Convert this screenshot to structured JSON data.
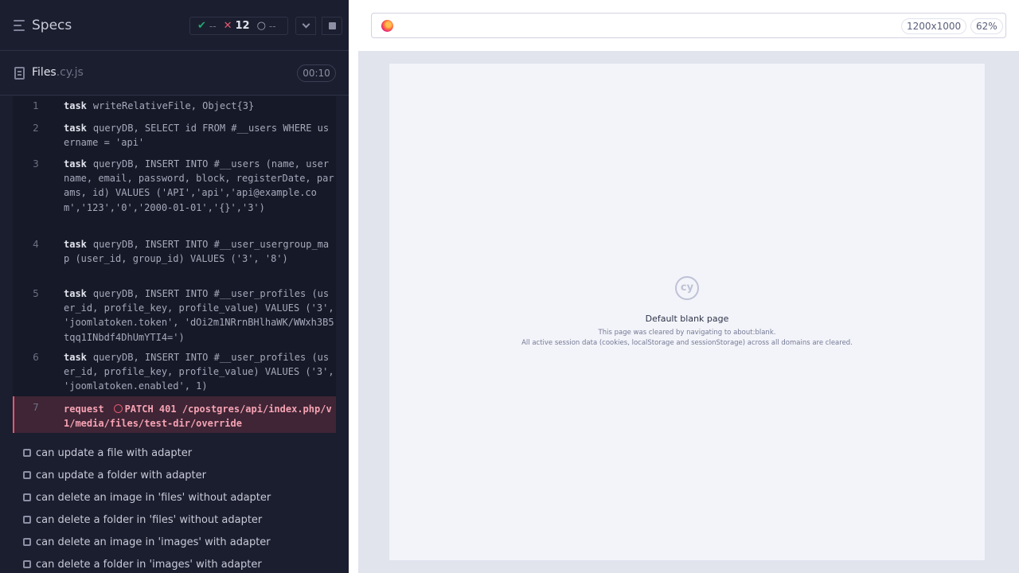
{
  "reporter": {
    "title": "Specs",
    "stats": {
      "passed": "--",
      "failed": "12",
      "pending": "--"
    },
    "file": {
      "name": "Files",
      "ext": ".cy.js",
      "duration": "00:10"
    },
    "commands": [
      {
        "num": "1",
        "name": "task",
        "message": "writeRelativeFile, Object{3}"
      },
      {
        "num": "2",
        "name": "task",
        "message": "queryDB, SELECT id FROM #__users WHERE username = 'api'"
      },
      {
        "num": "3",
        "name": "task",
        "message": "queryDB, INSERT INTO #__users (name, username, email, password, block, registerDate, params, id) VALUES ('API','api','api@example.com','123','0','2000-01-01','{}','3')"
      },
      {
        "num": "4",
        "name": "task",
        "message": "queryDB, INSERT INTO #__user_usergroup_map (user_id, group_id) VALUES ('3', '8')"
      },
      {
        "num": "5",
        "name": "task",
        "message": "queryDB, INSERT INTO #__user_profiles (user_id, profile_key, profile_value) VALUES ('3', 'joomlatoken.token', 'dOi2m1NRrnBHlhaWK/WWxh3B5tqq1INbdf4DhUmYTI4=')"
      },
      {
        "num": "6",
        "name": "task",
        "message": "queryDB, INSERT INTO #__user_profiles (user_id, profile_key, profile_value) VALUES ('3', 'joomlatoken.enabled', 1)"
      },
      {
        "num": "7",
        "name": "request",
        "message": "PATCH 401 /cpostgres/api/index.php/v1/media/files/test-dir/override"
      }
    ],
    "tests": [
      "can update a file with adapter",
      "can update a folder with adapter",
      "can delete an image in 'files' without adapter",
      "can delete a folder in 'files' without adapter",
      "can delete an image in 'images' with adapter",
      "can delete a folder in 'images' with adapter"
    ]
  },
  "aut": {
    "viewport": "1200x1000",
    "zoom": "62%",
    "logo_text": "cy",
    "blank_title": "Default blank page",
    "blank_line1": "This page was cleared by navigating to about:blank.",
    "blank_line2": "All active session data (cookies, localStorage and sessionStorage) across all domains are cleared."
  },
  "colors": {
    "passed": "#1fa971",
    "failed": "#e45770",
    "panel_bg": "#1b1e2e"
  }
}
